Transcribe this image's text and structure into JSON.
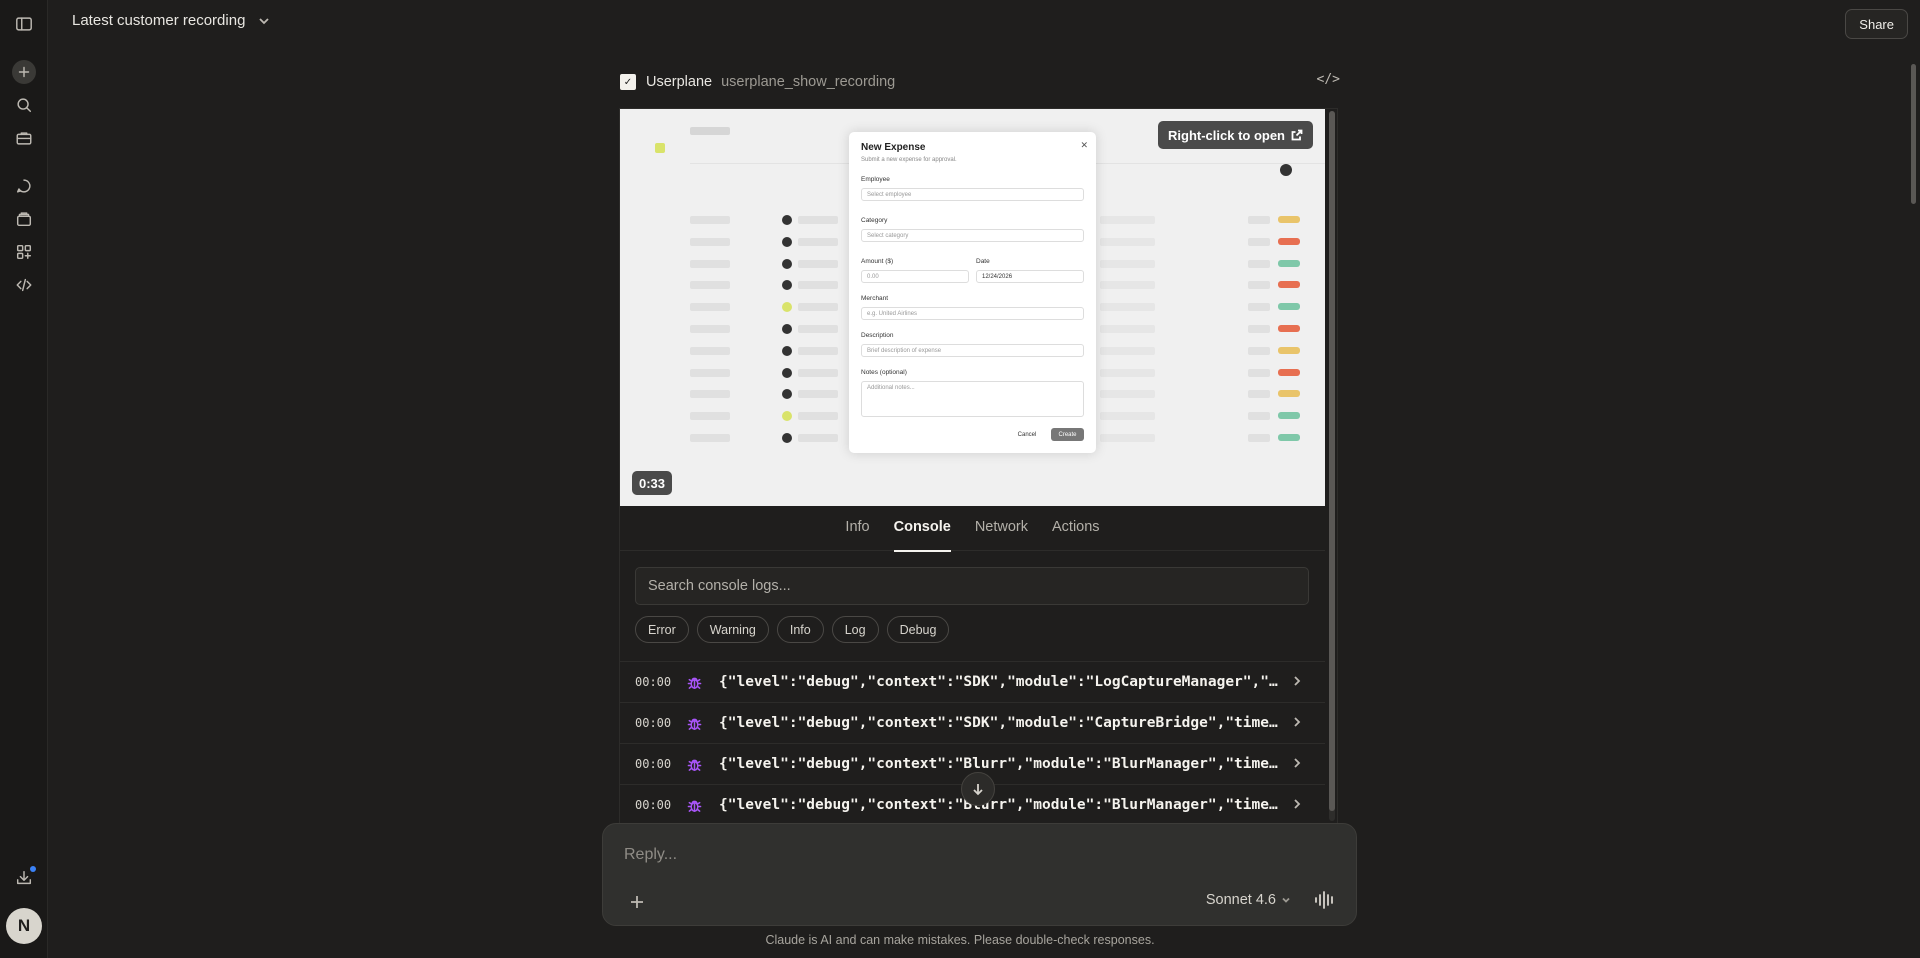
{
  "header": {
    "title": "Latest customer recording",
    "share_label": "Share"
  },
  "artifact": {
    "brand": "Userplane",
    "subtitle": "userplane_show_recording",
    "code_label": "</>"
  },
  "video": {
    "open_label": "Right-click to open",
    "timestamp": "0:33",
    "modal": {
      "title": "New Expense",
      "subtitle": "Submit a new expense for approval.",
      "employee_label": "Employee",
      "employee_placeholder": "Select employee",
      "category_label": "Category",
      "category_placeholder": "Select category",
      "amount_label": "Amount ($)",
      "amount_placeholder": "0.00",
      "date_label": "Date",
      "date_value": "12/24/2026",
      "merchant_label": "Merchant",
      "merchant_placeholder": "e.g. United Airlines",
      "description_label": "Description",
      "description_placeholder": "Brief description of expense",
      "notes_label": "Notes (optional)",
      "notes_placeholder": "Additional notes...",
      "cancel_label": "Cancel",
      "create_label": "Create"
    }
  },
  "tabs": [
    "Info",
    "Console",
    "Network",
    "Actions"
  ],
  "active_tab": "Console",
  "search": {
    "placeholder": "Search console logs..."
  },
  "filters": [
    "Error",
    "Warning",
    "Info",
    "Log",
    "Debug"
  ],
  "logs": [
    {
      "time": "00:00",
      "text": "{\"level\":\"debug\",\"context\":\"SDK\",\"module\":\"LogCaptureManager\",\"ti…"
    },
    {
      "time": "00:00",
      "text": "{\"level\":\"debug\",\"context\":\"SDK\",\"module\":\"CaptureBridge\",\"time\":…"
    },
    {
      "time": "00:00",
      "text": "{\"level\":\"debug\",\"context\":\"Blurr\",\"module\":\"BlurManager\",\"time\":…"
    },
    {
      "time": "00:00",
      "text": "{\"level\":\"debug\",\"context\":\"Blurr\",\"module\":\"BlurManager\",\"time\":…"
    }
  ],
  "reply": {
    "placeholder": "Reply...",
    "model": "Sonnet 4.6"
  },
  "disclaimer": "Claude is AI and can make mistakes. Please double-check responses.",
  "user": {
    "initial": "N"
  },
  "colors": {
    "accent_debug": "#a855f7",
    "notification": "#3b82f6"
  }
}
